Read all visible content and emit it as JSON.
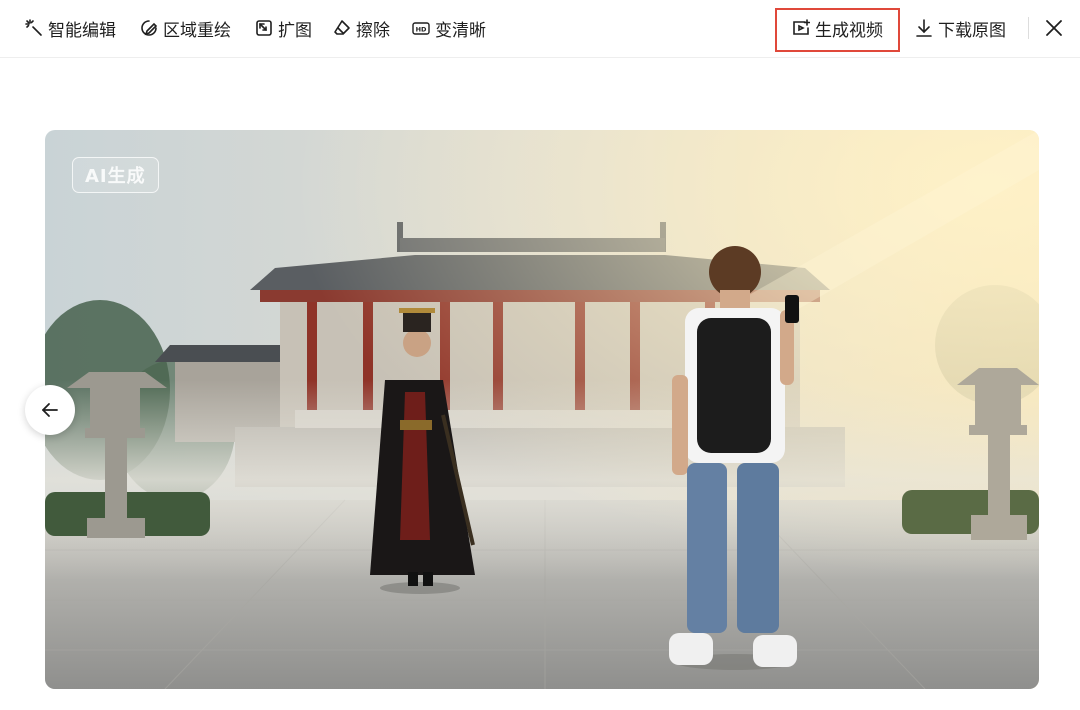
{
  "toolbar": {
    "tools": [
      {
        "label": "智能编辑",
        "icon": "magic-wand-icon"
      },
      {
        "label": "区域重绘",
        "icon": "brush-redraw-icon"
      },
      {
        "label": "扩图",
        "icon": "expand-image-icon"
      },
      {
        "label": "擦除",
        "icon": "eraser-icon"
      },
      {
        "label": "变清晰",
        "icon": "hd-icon"
      },
      {
        "label": "生成视频",
        "icon": "generate-video-icon",
        "highlighted": true
      },
      {
        "label": "下载原图",
        "icon": "download-icon"
      }
    ],
    "close_icon": "close-icon",
    "highlight_color": "#e0483a"
  },
  "image": {
    "badge": "AI生成",
    "prev_icon": "arrow-left-icon"
  }
}
